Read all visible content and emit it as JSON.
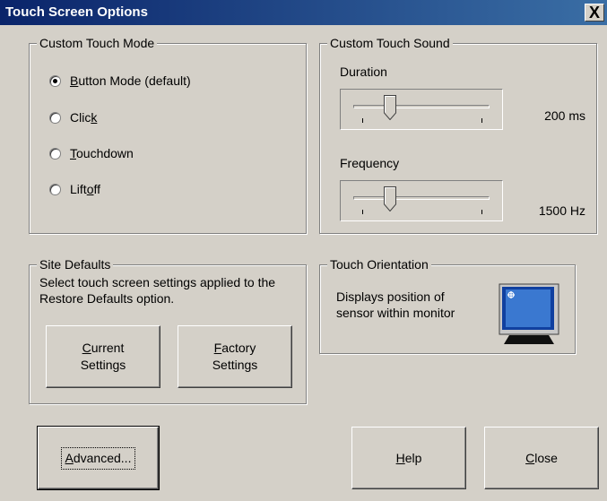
{
  "window": {
    "title": "Touch Screen Options",
    "close_glyph": "X"
  },
  "custom_touch_mode": {
    "legend": "Custom Touch Mode",
    "options": [
      {
        "pre": "",
        "u": "B",
        "post": "utton Mode (default)",
        "selected": true
      },
      {
        "pre": "Clic",
        "u": "k",
        "post": "",
        "selected": false
      },
      {
        "pre": "",
        "u": "T",
        "post": "ouchdown",
        "selected": false
      },
      {
        "pre": "Lift",
        "u": "o",
        "post": "ff",
        "selected": false
      }
    ]
  },
  "custom_touch_sound": {
    "legend": "Custom Touch Sound",
    "duration": {
      "label": "Duration",
      "value": "200 ms",
      "level": 0.33
    },
    "frequency": {
      "label": "Frequency",
      "value": "1500 Hz",
      "level": 0.33
    }
  },
  "site_defaults": {
    "legend": "Site Defaults",
    "description": "Select touch screen settings applied to the Restore Defaults option.",
    "current_button": {
      "u": "C",
      "rest": "urrent",
      "line2": "Settings"
    },
    "factory_button": {
      "u": "F",
      "rest": "actory",
      "line2": "Settings"
    }
  },
  "touch_orientation": {
    "legend": "Touch Orientation",
    "description": "Displays position of sensor within monitor",
    "icon": "monitor-icon"
  },
  "buttons": {
    "advanced": {
      "u": "A",
      "rest": "dvanced..."
    },
    "help": {
      "u": "H",
      "rest": "elp"
    },
    "close": {
      "u": "C",
      "rest": "lose"
    }
  },
  "colors": {
    "titlebar_start": "#0a246a",
    "titlebar_end": "#3a6ea5",
    "face": "#d4d0c8"
  }
}
